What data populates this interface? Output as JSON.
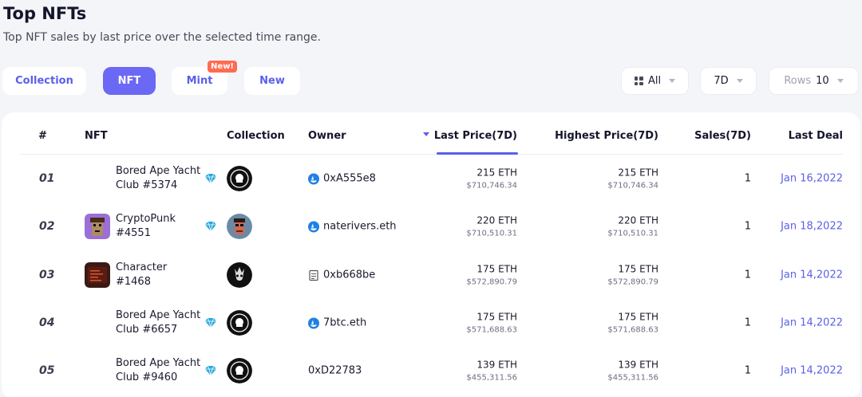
{
  "header": {
    "title": "Top NFTs",
    "subtitle": "Top NFT sales by last price over the selected time range."
  },
  "tabs": [
    {
      "label": "Collection",
      "active": false
    },
    {
      "label": "NFT",
      "active": true
    },
    {
      "label": "Mint",
      "active": false,
      "badge": "New!"
    },
    {
      "label": "New",
      "active": false
    }
  ],
  "filters": {
    "category": {
      "icon": "grid-icon",
      "value": "All"
    },
    "range": {
      "value": "7D"
    },
    "rows": {
      "label": "Rows",
      "value": "10"
    }
  },
  "table": {
    "columns": {
      "rank": "#",
      "nft": "NFT",
      "collection": "Collection",
      "owner": "Owner",
      "last_price": "Last Price(7D)",
      "highest_price": "Highest Price(7D)",
      "sales": "Sales(7D)",
      "last_deal": "Last Deal"
    },
    "sorted_column": "last_price",
    "rows": [
      {
        "rank": "01",
        "nft": "Bored Ape Yacht Club #5374",
        "verified": true,
        "owner": "0xA555e8",
        "owner_icon": "opensea-icon",
        "last_eth": "215 ETH",
        "last_usd": "$710,746.34",
        "high_eth": "215 ETH",
        "high_usd": "$710,746.34",
        "sales": "1",
        "deal": "Jan 16,2022"
      },
      {
        "rank": "02",
        "nft": "CryptoPunk #4551",
        "verified": true,
        "owner": "naterivers.eth",
        "owner_icon": "opensea-icon",
        "last_eth": "220 ETH",
        "last_usd": "$710,510.31",
        "high_eth": "220 ETH",
        "high_usd": "$710,510.31",
        "sales": "1",
        "deal": "Jan 18,2022"
      },
      {
        "rank": "03",
        "nft": "Character #1468",
        "verified": false,
        "owner": "0xb668be",
        "owner_icon": "document-icon",
        "last_eth": "175 ETH",
        "last_usd": "$572,890.79",
        "high_eth": "175 ETH",
        "high_usd": "$572,890.79",
        "sales": "1",
        "deal": "Jan 14,2022"
      },
      {
        "rank": "04",
        "nft": "Bored Ape Yacht Club #6657",
        "verified": true,
        "owner": "7btc.eth",
        "owner_icon": "opensea-icon",
        "last_eth": "175 ETH",
        "last_usd": "$571,688.63",
        "high_eth": "175 ETH",
        "high_usd": "$571,688.63",
        "sales": "1",
        "deal": "Jan 14,2022"
      },
      {
        "rank": "05",
        "nft": "Bored Ape Yacht Club #9460",
        "verified": true,
        "owner": "0xD22783",
        "owner_icon": "",
        "last_eth": "139 ETH",
        "last_usd": "$455,311.56",
        "high_eth": "139 ETH",
        "high_usd": "$455,311.56",
        "sales": "1",
        "deal": "Jan 14,2022"
      }
    ]
  },
  "colors": {
    "accent": "#6b68f5",
    "link": "#5b5fe9",
    "badge": "#ff6b52",
    "background": "#f4f5f8"
  }
}
